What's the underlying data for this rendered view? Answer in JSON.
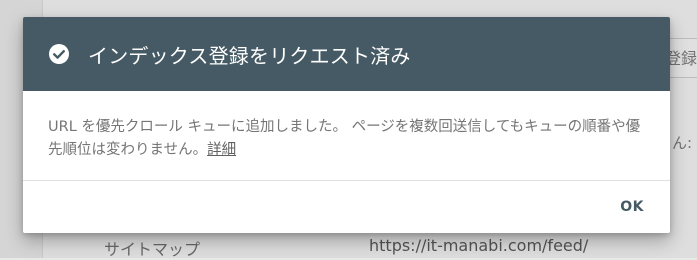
{
  "background": {
    "right_button_label": "登録を",
    "right_text": "ん:",
    "row_label": "サイトマップ",
    "row_value": "https://it-manabi.com/feed/"
  },
  "dialog": {
    "icon": "check-circle-icon",
    "title": "インデックス登録をリクエスト済み",
    "body_text": "URL を優先クロール キューに追加しました。 ページを複数回送信してもキューの順番や優先順位は変わりません。",
    "detail_link": "詳細",
    "ok_label": "OK",
    "header_color": "#455a64"
  }
}
